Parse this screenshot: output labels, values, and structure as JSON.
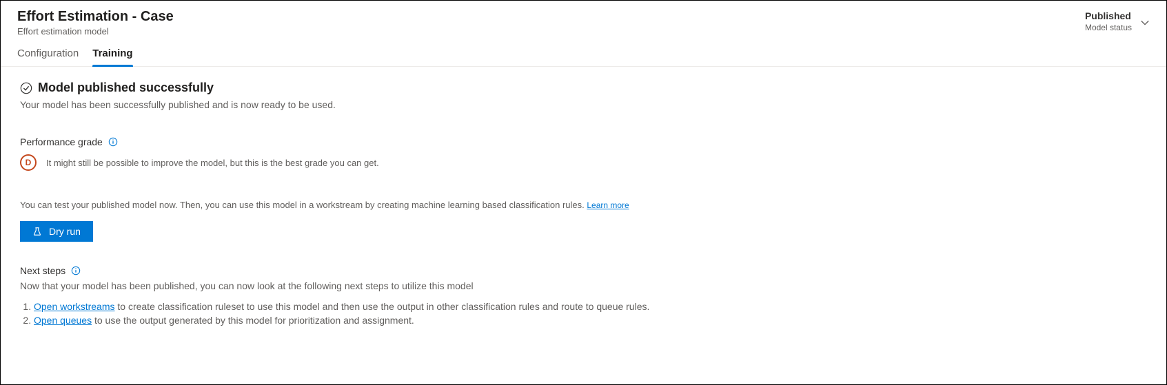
{
  "header": {
    "title": "Effort Estimation - Case",
    "subtitle": "Effort estimation model",
    "status_value": "Published",
    "status_label": "Model status"
  },
  "tabs": {
    "configuration": "Configuration",
    "training": "Training"
  },
  "success": {
    "title": "Model published successfully",
    "subtitle": "Your model has been successfully published and is now ready to be used."
  },
  "performance": {
    "label": "Performance grade",
    "grade_letter": "D",
    "grade_text": "It might still be possible to improve the model, but this is the best grade you can get."
  },
  "test": {
    "text": "You can test your published model now. Then, you can use this model in a workstream by creating machine learning based classification rules. ",
    "learn_more": "Learn more"
  },
  "dry_run_label": "Dry run",
  "next_steps": {
    "label": "Next steps",
    "subtitle": "Now that your model has been published, you can now look at the following next steps to utilize this model",
    "item1_link": "Open workstreams",
    "item1_text": " to create classification ruleset to use this model and then use the output in other classification rules and route to queue rules.",
    "item2_link": "Open queues",
    "item2_text": " to use the output generated by this model for prioritization and assignment."
  }
}
